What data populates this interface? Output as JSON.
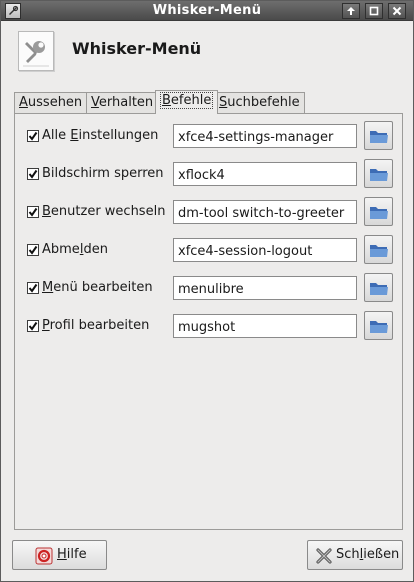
{
  "window": {
    "title": "Whisker-Menü",
    "buttons": [
      "window-menu",
      "up",
      "maximize",
      "close"
    ]
  },
  "header": {
    "title": "Whisker-Menü",
    "icon": "settings-tool-icon"
  },
  "tabs": [
    {
      "pre": "",
      "accel": "A",
      "post": "ussehen",
      "active": false
    },
    {
      "pre": "",
      "accel": "V",
      "post": "erhalten",
      "active": false
    },
    {
      "pre": "",
      "accel": "B",
      "post": "efehle",
      "active": true
    },
    {
      "pre": "",
      "accel": "S",
      "post": "uchbefehle",
      "active": false
    }
  ],
  "commands": [
    {
      "pre": "Alle ",
      "accel": "E",
      "post": "instellungen",
      "checked": true,
      "command": "xfce4-settings-manager"
    },
    {
      "pre": "Bildschirm sperren",
      "accel": "",
      "post": "",
      "checked": true,
      "command": "xflock4"
    },
    {
      "pre": "",
      "accel": "B",
      "post": "enutzer wechseln",
      "checked": true,
      "command": "dm-tool switch-to-greeter"
    },
    {
      "pre": "Abme",
      "accel": "l",
      "post": "den",
      "checked": true,
      "command": "xfce4-session-logout"
    },
    {
      "pre": "",
      "accel": "M",
      "post": "enü bearbeiten",
      "checked": true,
      "command": "menulibre"
    },
    {
      "pre": "",
      "accel": "P",
      "post": "rofil bearbeiten",
      "checked": true,
      "command": "mugshot"
    }
  ],
  "footer": {
    "help": {
      "pre": "",
      "accel": "H",
      "post": "ilfe",
      "icon": "help-lifebuoy-icon"
    },
    "close": {
      "pre": "Sch",
      "accel": "l",
      "post": "ießen",
      "icon": "close-x-icon"
    }
  },
  "colors": {
    "titlebar": "#5a5a5a",
    "window_bg": "#edeceb",
    "folder_blue": "#4a7bc4"
  }
}
